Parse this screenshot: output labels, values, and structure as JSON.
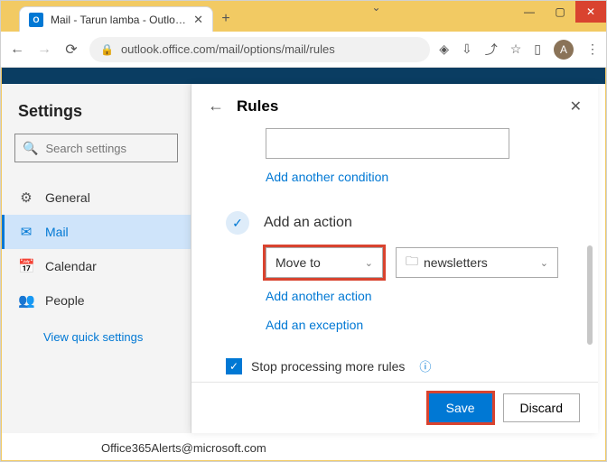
{
  "browser": {
    "tab_title": "Mail - Tarun lamba - Outlook",
    "url": "outlook.office.com/mail/options/mail/rules",
    "avatar_initial": "A"
  },
  "settings": {
    "title": "Settings",
    "search_placeholder": "Search settings",
    "nav": {
      "general": "General",
      "mail": "Mail",
      "calendar": "Calendar",
      "people": "People"
    },
    "quick_link": "View quick settings"
  },
  "rules": {
    "title": "Rules",
    "add_condition": "Add another condition",
    "action_section": "Add an action",
    "action_dropdown": "Move to",
    "folder_dropdown": "newsletters",
    "add_action": "Add another action",
    "add_exception": "Add an exception",
    "stop_processing": "Stop processing more rules",
    "save": "Save",
    "discard": "Discard"
  },
  "footer_email": "Office365Alerts@microsoft.com"
}
